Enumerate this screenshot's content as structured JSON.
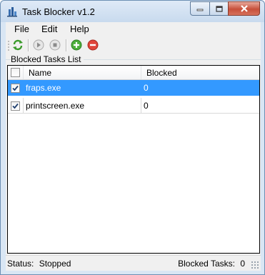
{
  "window": {
    "title": "Task Blocker v1.2",
    "icon": "app-chart-icon"
  },
  "menu": {
    "items": [
      "File",
      "Edit",
      "Help"
    ]
  },
  "toolbar": {
    "buttons": [
      "refresh-icon",
      "start-icon",
      "stop-icon",
      "add-icon",
      "remove-icon"
    ]
  },
  "group": {
    "label": "Blocked Tasks List"
  },
  "list": {
    "columns": [
      "Name",
      "Blocked"
    ],
    "header_checked": false,
    "rows": [
      {
        "name": "fraps.exe",
        "blocked": "0",
        "checked": true,
        "selected": true
      },
      {
        "name": "printscreen.exe",
        "blocked": "0",
        "checked": true,
        "selected": false
      }
    ]
  },
  "status": {
    "label": "Status:",
    "value": "Stopped",
    "count_label": "Blocked Tasks:",
    "count": "0"
  },
  "colors": {
    "selection": "#3399ff",
    "close_button": "#c7503a",
    "titlebar": "#c8daee"
  }
}
